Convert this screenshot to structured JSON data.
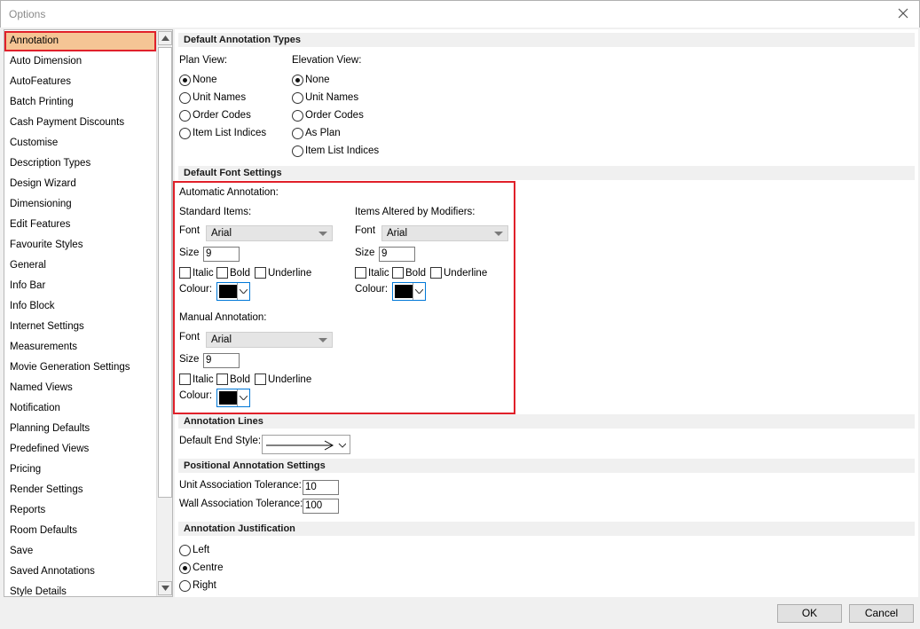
{
  "window": {
    "title": "Options"
  },
  "sidebar": {
    "items": [
      {
        "label": "Annotation",
        "selected": true
      },
      {
        "label": "Auto Dimension"
      },
      {
        "label": "AutoFeatures"
      },
      {
        "label": "Batch Printing"
      },
      {
        "label": "Cash Payment Discounts"
      },
      {
        "label": "Customise"
      },
      {
        "label": "Description Types"
      },
      {
        "label": "Design Wizard"
      },
      {
        "label": "Dimensioning"
      },
      {
        "label": "Edit Features"
      },
      {
        "label": "Favourite Styles"
      },
      {
        "label": "General"
      },
      {
        "label": "Info Bar"
      },
      {
        "label": "Info Block"
      },
      {
        "label": "Internet Settings"
      },
      {
        "label": "Measurements"
      },
      {
        "label": "Movie Generation Settings"
      },
      {
        "label": "Named Views"
      },
      {
        "label": "Notification"
      },
      {
        "label": "Planning Defaults"
      },
      {
        "label": "Predefined Views"
      },
      {
        "label": "Pricing"
      },
      {
        "label": "Render Settings"
      },
      {
        "label": "Reports"
      },
      {
        "label": "Room Defaults"
      },
      {
        "label": "Save"
      },
      {
        "label": "Saved Annotations"
      },
      {
        "label": "Style Details"
      }
    ]
  },
  "annotation_types": {
    "header": "Default Annotation Types",
    "plan_view": {
      "label": "Plan View:",
      "options": [
        "None",
        "Unit Names",
        "Order Codes",
        "Item List Indices"
      ],
      "selected": "None"
    },
    "elevation_view": {
      "label": "Elevation View:",
      "options": [
        "None",
        "Unit Names",
        "Order Codes",
        "As Plan",
        "Item List Indices"
      ],
      "selected": "None"
    }
  },
  "font_settings": {
    "header": "Default Font Settings",
    "automatic_label": "Automatic Annotation:",
    "standard": {
      "label": "Standard Items:",
      "font_label": "Font",
      "font": "Arial",
      "size_label": "Size",
      "size": "9",
      "italic": "Italic",
      "bold": "Bold",
      "underline": "Underline",
      "colour_label": "Colour:"
    },
    "modifiers": {
      "label": "Items Altered by Modifiers:",
      "font_label": "Font",
      "font": "Arial",
      "size_label": "Size",
      "size": "9",
      "italic": "Italic",
      "bold": "Bold",
      "underline": "Underline",
      "colour_label": "Colour:"
    },
    "manual": {
      "label": "Manual Annotation:",
      "font_label": "Font",
      "font": "Arial",
      "size_label": "Size",
      "size": "9",
      "italic": "Italic",
      "bold": "Bold",
      "underline": "Underline",
      "colour_label": "Colour:"
    },
    "colour_value": "#000000"
  },
  "annotation_lines": {
    "header": "Annotation Lines",
    "end_style_label": "Default End Style:"
  },
  "positional": {
    "header": "Positional Annotation Settings",
    "unit_label": "Unit Association Tolerance:",
    "unit_value": "10",
    "wall_label": "Wall Association Tolerance:",
    "wall_value": "100"
  },
  "justification": {
    "header": "Annotation Justification",
    "options": [
      "Left",
      "Centre",
      "Right"
    ],
    "selected": "Centre"
  },
  "footer": {
    "ok": "OK",
    "cancel": "Cancel"
  },
  "colors": {
    "selection": "#f5c595",
    "highlight_border": "#e0202a",
    "focus": "#0078d7"
  }
}
